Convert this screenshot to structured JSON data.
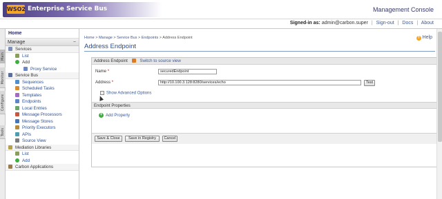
{
  "header": {
    "logo_mark": "WSO2",
    "product_name": "Enterprise Service Bus",
    "console_title": "Management Console"
  },
  "userbar": {
    "signed_in_label": "Signed-in as:",
    "user": "admin@carbon.super",
    "sign_out": "Sign-out",
    "docs": "Docs",
    "about": "About"
  },
  "vtabs": [
    "Main",
    "Monitor",
    "Configure",
    "Tools"
  ],
  "sidebar": {
    "home": "Home",
    "manage": "Manage",
    "services": "Services",
    "services_list": "List",
    "services_add": "Add",
    "proxy_service": "Proxy Service",
    "service_bus": "Service Bus",
    "sequences": "Sequences",
    "scheduled_tasks": "Scheduled Tasks",
    "templates": "Templates",
    "endpoints": "Endpoints",
    "local_entries": "Local Entries",
    "message_processors": "Message Processors",
    "message_stores": "Message Stores",
    "priority_executors": "Priority Executors",
    "apis": "APIs",
    "source_view": "Source View",
    "mediation_libraries": "Mediation Libraries",
    "ml_list": "List",
    "ml_add": "Add",
    "carbon_applications": "Carbon Applications"
  },
  "main": {
    "breadcrumb": {
      "home": "Home",
      "manage": "Manage",
      "service_bus": "Service Bus",
      "endpoints": "Endpoints",
      "current": "Address Endpoint",
      "sep": " > "
    },
    "help": "Help",
    "title": "Address Endpoint",
    "panel_title": "Address Endpoint",
    "switch_source": "Switch to source view",
    "name_label": "Name",
    "name_value": "securedEndpoint",
    "address_label": "Address",
    "address_value": "http://10.100.3.128:8280/services/echo",
    "required_mark": "*",
    "test_button": "Test",
    "show_advanced": "Show Advanced Options",
    "endpoint_properties": "Endpoint Properties",
    "add_property": "Add Property",
    "save_close": "Save & Close",
    "save_registry": "Save in Registry",
    "cancel": "Cancel"
  },
  "colors": {
    "accent": "#2b4a8a",
    "link": "#3b5998",
    "logo_purple": "#4b3f7f",
    "logo_orange": "#f5a623"
  }
}
